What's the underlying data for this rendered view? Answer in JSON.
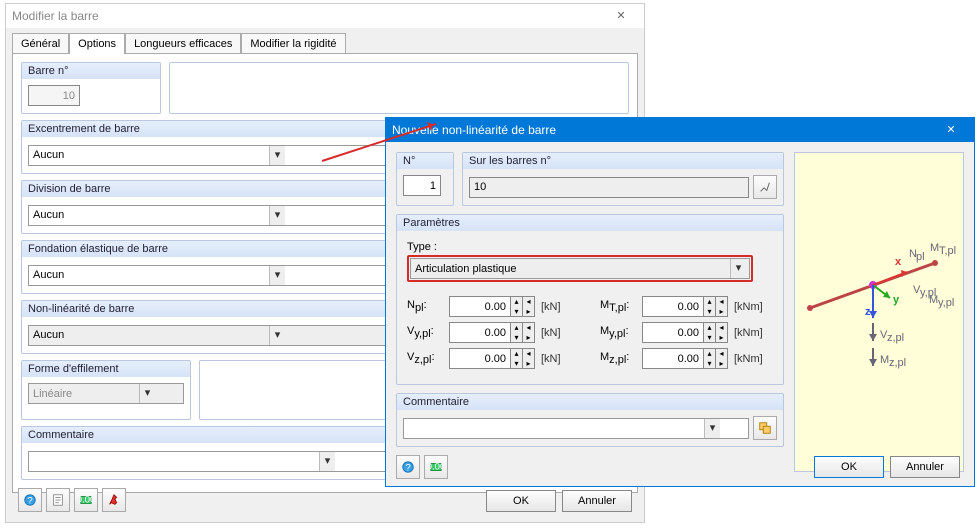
{
  "dialog1": {
    "title": "Modifier la barre",
    "tabs": [
      "Général",
      "Options",
      "Longueurs efficaces",
      "Modifier la rigidité"
    ],
    "barre_no_label": "Barre n°",
    "barre_no": "10",
    "excent_label": "Excentrement de barre",
    "division_label": "Division de barre",
    "fondation_label": "Fondation élastique de barre",
    "nonlin_label": "Non-linéarité de barre",
    "aucun": "Aucun",
    "forme_label": "Forme d'effilement",
    "forme_val": "Linéaire",
    "comment_label": "Commentaire",
    "ok": "OK",
    "cancel": "Annuler"
  },
  "dialog2": {
    "title": "Nouvelle non-linéarité de barre",
    "no_label": "N°",
    "no_val": "1",
    "bars_label": "Sur les barres n°",
    "bars_val": "10",
    "params_label": "Paramètres",
    "type_label": "Type :",
    "type_val": "Articulation plastique",
    "fields": {
      "Npl": {
        "label": "N",
        "sub": "pl",
        "val": "0.00",
        "unit": "[kN]"
      },
      "Vypl": {
        "label": "V",
        "sub": "y,pl",
        "val": "0.00",
        "unit": "[kN]"
      },
      "Vzpl": {
        "label": "V",
        "sub": "z,pl",
        "val": "0.00",
        "unit": "[kN]"
      },
      "MTpl": {
        "label": "M",
        "sub": "T,pl",
        "val": "0.00",
        "unit": "[kNm]"
      },
      "Mypl": {
        "label": "M",
        "sub": "y,pl",
        "val": "0.00",
        "unit": "[kNm]"
      },
      "Mzpl": {
        "label": "M",
        "sub": "z,pl",
        "val": "0.00",
        "unit": "[kNm]"
      }
    },
    "comment_label": "Commentaire",
    "ok": "OK",
    "cancel": "Annuler"
  }
}
